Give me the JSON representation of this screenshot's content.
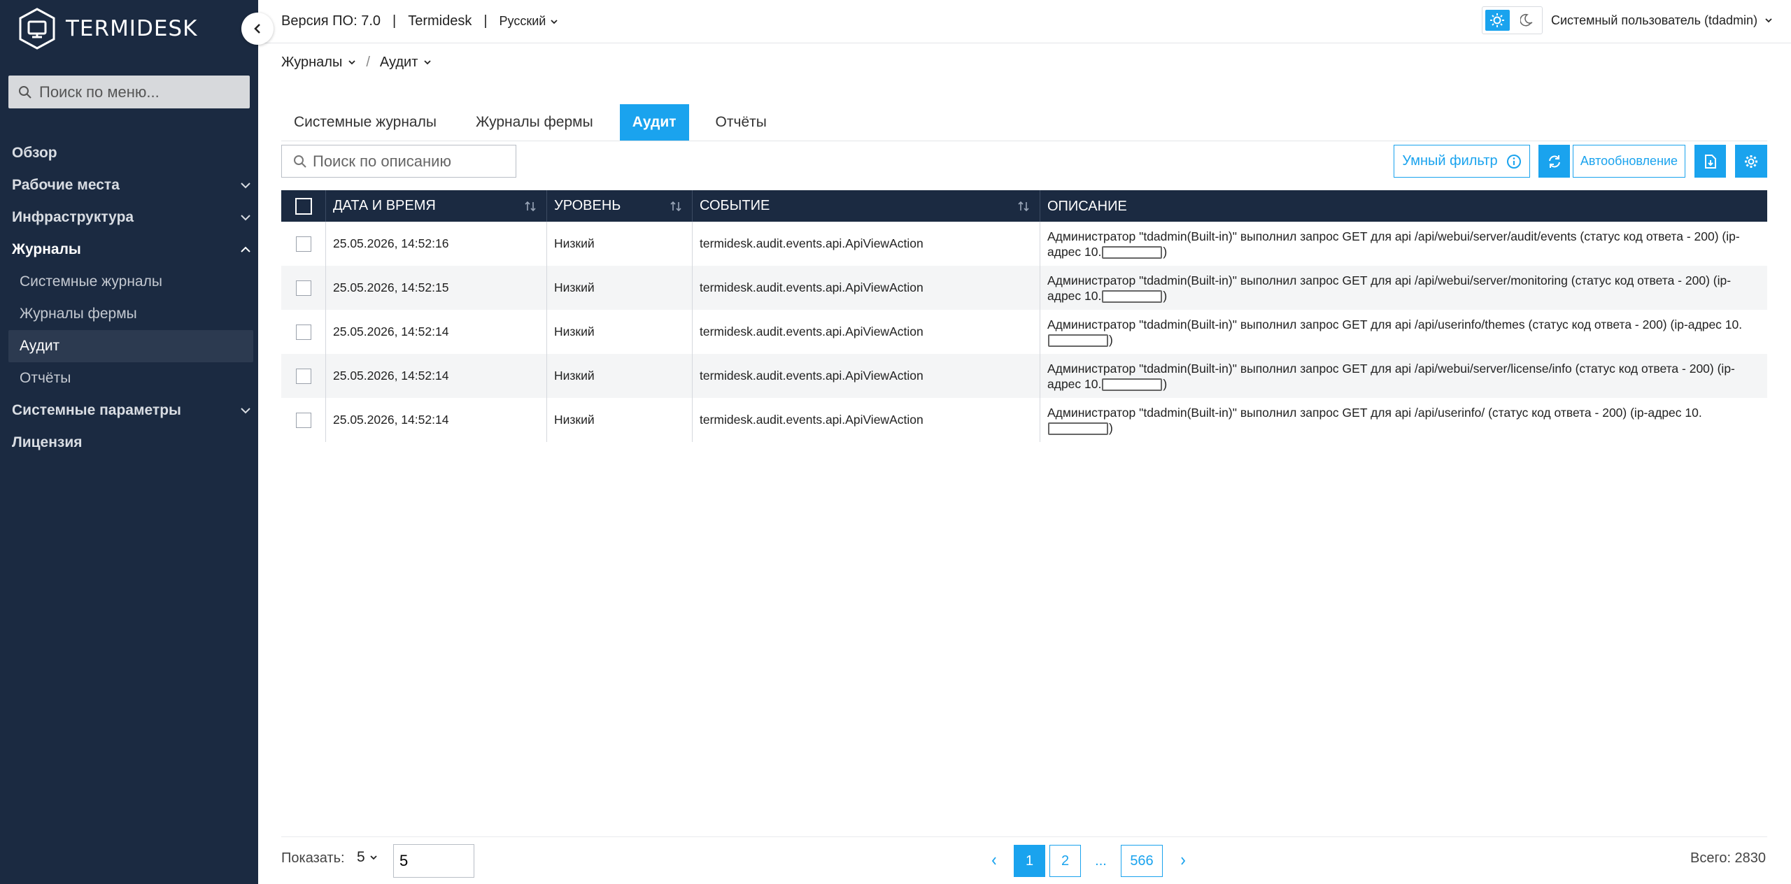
{
  "app": {
    "brand": "TERMIDESK",
    "version": "Версия ПО: 7.0",
    "product": "Termidesk",
    "language": "Русский",
    "user": "Системный пользователь (tdadmin)"
  },
  "sidebar": {
    "search_placeholder": "Поиск по меню...",
    "items": [
      {
        "label": "Обзор"
      },
      {
        "label": "Рабочие места"
      },
      {
        "label": "Инфраструктура"
      },
      {
        "label": "Журналы"
      },
      {
        "label": "Системные параметры"
      },
      {
        "label": "Лицензия"
      }
    ],
    "journals_sub": [
      {
        "label": "Системные журналы"
      },
      {
        "label": "Журналы фермы"
      },
      {
        "label": "Аудит"
      },
      {
        "label": "Отчёты"
      }
    ]
  },
  "breadcrumb": {
    "first": "Журналы",
    "second": "Аудит"
  },
  "tabs": [
    {
      "label": "Системные журналы"
    },
    {
      "label": "Журналы фермы"
    },
    {
      "label": "Аудит"
    },
    {
      "label": "Отчёты"
    }
  ],
  "toolbar": {
    "search_placeholder": "Поиск по описанию",
    "smart_filter": "Умный фильтр",
    "autoupdate": "Автообновление"
  },
  "table": {
    "headers": {
      "date": "ДАТА И ВРЕМЯ",
      "level": "УРОВЕНЬ",
      "event": "СОБЫТИЕ",
      "description": "ОПИСАНИЕ"
    },
    "rows": [
      {
        "date": "25.05.2026, 14:52:16",
        "level": "Низкий",
        "event": "termidesk.audit.events.api.ApiViewAction",
        "desc_a": "Администратор \"tdadmin(Built-in)\" выполнил запрос GET для api /api/webui/server/audit/events (статус код ответа - 200) (ip-адрес 10.",
        "desc_b": ")"
      },
      {
        "date": "25.05.2026, 14:52:15",
        "level": "Низкий",
        "event": "termidesk.audit.events.api.ApiViewAction",
        "desc_a": "Администратор \"tdadmin(Built-in)\" выполнил запрос GET для api /api/webui/server/monitoring (статус код ответа - 200) (ip-адрес 10.",
        "desc_b": ")"
      },
      {
        "date": "25.05.2026, 14:52:14",
        "level": "Низкий",
        "event": "termidesk.audit.events.api.ApiViewAction",
        "desc_a": "Администратор \"tdadmin(Built-in)\" выполнил запрос GET для api /api/userinfo/themes (статус код ответа - 200) (ip-адрес 10.",
        "desc_b": ")"
      },
      {
        "date": "25.05.2026, 14:52:14",
        "level": "Низкий",
        "event": "termidesk.audit.events.api.ApiViewAction",
        "desc_a": "Администратор \"tdadmin(Built-in)\" выполнил запрос GET для api /api/webui/server/license/info (статус код ответа - 200) (ip-адрес 10.",
        "desc_b": ")"
      },
      {
        "date": "25.05.2026, 14:52:14",
        "level": "Низкий",
        "event": "termidesk.audit.events.api.ApiViewAction",
        "desc_a": "Администратор \"tdadmin(Built-in)\" выполнил запрос GET для api /api/userinfo/ (статус код ответа - 200) (ip-адрес 10.",
        "desc_b": ")"
      }
    ]
  },
  "pagination": {
    "show_label": "Показать:",
    "page_size": "5",
    "page_input": "5",
    "pages": [
      "1",
      "2",
      "...",
      "566"
    ],
    "total": "Всего: 2830"
  },
  "colors": {
    "accent": "#1aa3ee",
    "sidebar_bg": "#1b2a41",
    "header_bg": "#1b2a41"
  }
}
